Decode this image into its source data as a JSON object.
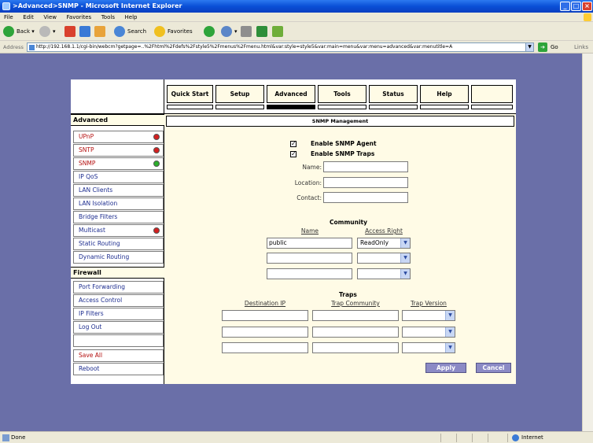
{
  "window": {
    "title": ">Advanced>SNMP - Microsoft Internet Explorer"
  },
  "menu": [
    "File",
    "Edit",
    "View",
    "Favorites",
    "Tools",
    "Help"
  ],
  "toolbar": {
    "back": "Back",
    "search": "Search",
    "favorites": "Favorites"
  },
  "address": {
    "label": "Address",
    "url": "http://192.168.1.1/cgi-bin/webcm?getpage=..%2Fhtml%2Fdefs%2Fstyle5%2Fmenus%2Fmenu.html&var:style=style5&var:main=menu&var:menu=advanced&var:menutitle=A",
    "go": "Go",
    "links": "Links"
  },
  "nav": {
    "tabs": [
      "Quick Start",
      "Setup",
      "Advanced",
      "Tools",
      "Status",
      "Help"
    ],
    "active": "Advanced"
  },
  "sidebar": {
    "sections": [
      {
        "header": "Advanced",
        "items": [
          {
            "label": "UPnP",
            "status": "red"
          },
          {
            "label": "SNTP",
            "status": "red"
          },
          {
            "label": "SNMP",
            "status": "green"
          },
          {
            "label": "IP QoS"
          },
          {
            "label": "LAN Clients"
          },
          {
            "label": "LAN Isolation"
          },
          {
            "label": "Bridge Filters"
          },
          {
            "label": "Multicast",
            "status": "red"
          },
          {
            "label": "Static Routing"
          },
          {
            "label": "Dynamic Routing"
          }
        ]
      },
      {
        "header": "Firewall",
        "items": [
          {
            "label": "Port Forwarding"
          },
          {
            "label": "Access Control"
          },
          {
            "label": "IP Filters"
          },
          {
            "label": "Log Out"
          }
        ]
      }
    ],
    "bottom": [
      {
        "label": "Save All"
      },
      {
        "label": "Reboot"
      }
    ]
  },
  "main": {
    "title": "SNMP Management",
    "enable_agent": "Enable SNMP Agent",
    "enable_traps": "Enable SNMP Traps",
    "name_label": "Name:",
    "location_label": "Location:",
    "contact_label": "Contact:",
    "community": {
      "title": "Community",
      "col_name": "Name",
      "col_access": "Access Right",
      "rows": [
        {
          "name": "public",
          "access": "ReadOnly"
        },
        {
          "name": "",
          "access": ""
        },
        {
          "name": "",
          "access": ""
        }
      ]
    },
    "traps": {
      "title": "Traps",
      "col_ip": "Destination IP",
      "col_community": "Trap Community",
      "col_version": "Trap Version",
      "rows": 3
    },
    "apply": "Apply",
    "cancel": "Cancel"
  },
  "status": {
    "text": "Done",
    "zone": "Internet"
  },
  "colors": {
    "accent": "#8b8ac5",
    "desktop": "#6a6fa8",
    "panel": "#fffbe6"
  }
}
